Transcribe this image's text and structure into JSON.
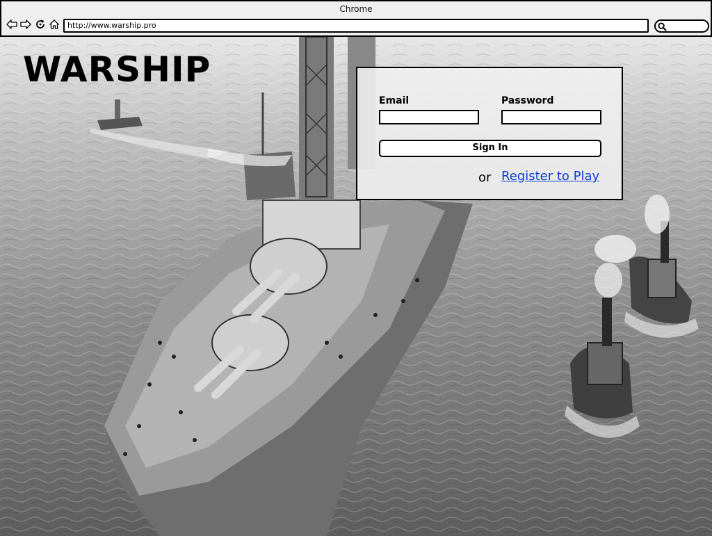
{
  "browser": {
    "title": "Chrome",
    "url": "http://www.warship.pro",
    "nav_icons": [
      "back-arrow-icon",
      "forward-arrow-icon",
      "reload-icon",
      "home-icon"
    ],
    "search_icon": "search-icon"
  },
  "page": {
    "brand": "WARSHIP",
    "hero_image": "battleship-photo",
    "login": {
      "email_label": "Email",
      "email_value": "",
      "password_label": "Password",
      "password_value": "",
      "sign_in_label": "Sign In",
      "or_text": "or",
      "register_label": "Register to Play"
    }
  },
  "colors": {
    "link": "#0b3dd6",
    "text": "#000000",
    "chrome_bg": "#efefef"
  }
}
